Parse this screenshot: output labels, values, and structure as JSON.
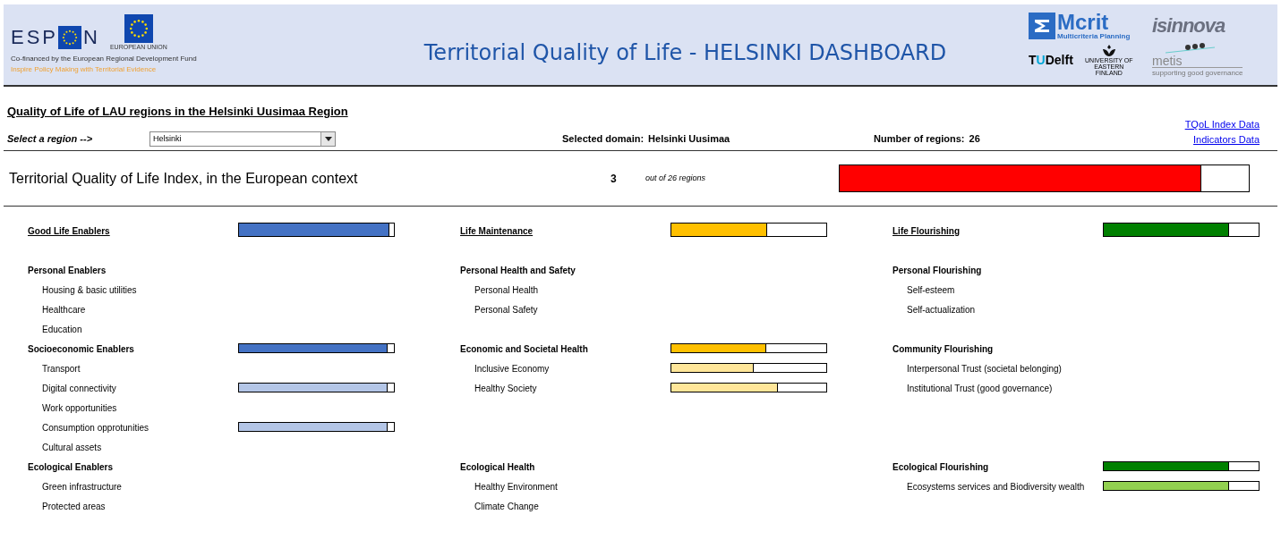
{
  "header": {
    "title": "Territorial Quality of Life - HELSINKI DASHBOARD",
    "espon": {
      "left": "ESP",
      "right": "N",
      "eu_caption": "EUROPEAN UNION",
      "cofinanced": "Co-financed by the European Regional Development Fund",
      "tagline": "Inspire Policy Making with Territorial Evidence"
    },
    "partners": {
      "mcrit": "Mcrit",
      "mcrit_sub": "Multicriteria Planning",
      "isinnova": "isinnova",
      "tu": "TU",
      "delft": "Delft",
      "uef": "UNIVERSITY OF EASTERN FINLAND",
      "metis": "metis",
      "metis_sub": "supporting good governance"
    }
  },
  "page_title": "Quality of Life of LAU regions in the Helsinki Uusimaa Region",
  "links": [
    "TQoL Index Data",
    "Indicators Data"
  ],
  "selector": {
    "label": "Select a region -->",
    "value": "Helsinki"
  },
  "selected_domain": {
    "label": "Selected domain:",
    "value": "Helsinki Uusimaa"
  },
  "region_count": {
    "label": "Number of  regions:",
    "value": "26"
  },
  "index": {
    "label": "Territorial Quality of Life Index, in the European context",
    "rank": "3",
    "out_of": "out of 26 regions",
    "level": 0.885,
    "color": "#ff0000"
  },
  "columns": [
    {
      "rows": [
        {
          "kind": "domain",
          "label": "Good Life Enablers",
          "level": 0.97,
          "color": "#4472c4"
        },
        {
          "kind": "blank"
        },
        {
          "kind": "group",
          "label": "Personal Enablers"
        },
        {
          "kind": "item",
          "label": "Housing & basic utilities"
        },
        {
          "kind": "item",
          "label": "Healthcare"
        },
        {
          "kind": "item",
          "label": "Education"
        },
        {
          "kind": "group",
          "label": "Socioeconomic Enablers",
          "level": 0.96,
          "color": "#4472c4"
        },
        {
          "kind": "item",
          "label": "Transport"
        },
        {
          "kind": "item",
          "label": "Digital connectivity",
          "level": 0.96,
          "color": "#b4c6e7"
        },
        {
          "kind": "item",
          "label": "Work opportunities"
        },
        {
          "kind": "item",
          "label": "Consumption opprotunities",
          "level": 0.96,
          "color": "#b4c6e7"
        },
        {
          "kind": "item",
          "label": "Cultural assets"
        },
        {
          "kind": "group",
          "label": "Ecological Enablers"
        },
        {
          "kind": "item",
          "label": "Green infrastructure"
        },
        {
          "kind": "item",
          "label": "Protected areas"
        }
      ]
    },
    {
      "rows": [
        {
          "kind": "domain",
          "label": "Life Maintenance",
          "level": 0.62,
          "color": "#ffc000"
        },
        {
          "kind": "blank"
        },
        {
          "kind": "group",
          "label": "Personal Health and Safety"
        },
        {
          "kind": "item",
          "label": "Personal Health"
        },
        {
          "kind": "item",
          "label": "Personal Safety"
        },
        {
          "kind": "blank"
        },
        {
          "kind": "group",
          "label": "Economic and Societal Health",
          "level": 0.61,
          "color": "#ffc000"
        },
        {
          "kind": "item",
          "label": "Inclusive Economy",
          "level": 0.53,
          "color": "#ffe699"
        },
        {
          "kind": "item",
          "label": "Healthy Society",
          "level": 0.69,
          "color": "#ffe699"
        },
        {
          "kind": "blank"
        },
        {
          "kind": "blank"
        },
        {
          "kind": "blank"
        },
        {
          "kind": "group",
          "label": "Ecological Health"
        },
        {
          "kind": "item",
          "label": "Healthy Environment"
        },
        {
          "kind": "item",
          "label": "Climate Change"
        }
      ]
    },
    {
      "rows": [
        {
          "kind": "domain",
          "label": "Life Flourishing",
          "level": 0.81,
          "color": "#008000"
        },
        {
          "kind": "blank"
        },
        {
          "kind": "group",
          "label": "Personal Flourishing"
        },
        {
          "kind": "item",
          "label": "Self-esteem"
        },
        {
          "kind": "item",
          "label": "Self-actualization"
        },
        {
          "kind": "blank"
        },
        {
          "kind": "group",
          "label": "Community Flourishing"
        },
        {
          "kind": "item",
          "label": "Interpersonal Trust (societal belonging)"
        },
        {
          "kind": "item",
          "label": "Institutional Trust (good governance)"
        },
        {
          "kind": "blank"
        },
        {
          "kind": "blank"
        },
        {
          "kind": "blank"
        },
        {
          "kind": "group",
          "label": "Ecological Flourishing",
          "level": 0.81,
          "color": "#008000"
        },
        {
          "kind": "item",
          "label": "Ecosystems services and Biodiversity wealth",
          "level": 0.81,
          "color": "#92d050"
        }
      ]
    }
  ]
}
